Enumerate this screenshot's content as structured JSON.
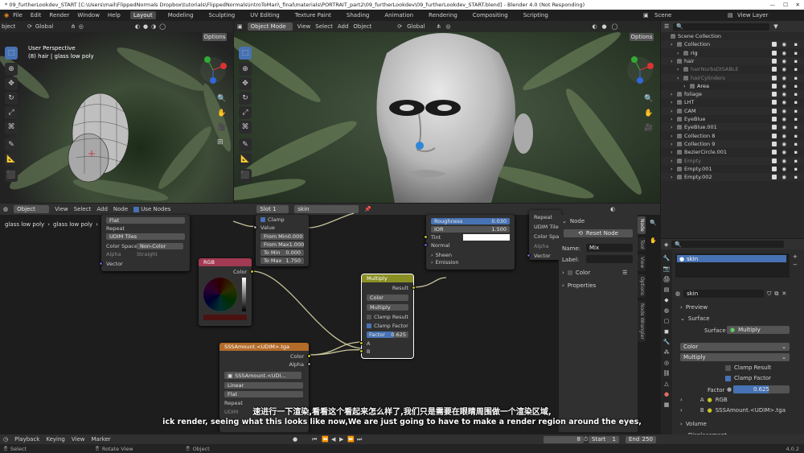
{
  "title_bar": {
    "text": "* 09_furtherLookdev_START [C:\\Users\\mail\\FlippedNormals Dropbox\\tutorials\\FlippedNormals\\introToMari\\_final\\materials\\PORTRAIT_part2\\09_furtherLookdev\\09_furtherLookdev_START.blend] - Blender 4.0 (Not Responding)"
  },
  "menu": {
    "file": "File",
    "edit": "Edit",
    "render": "Render",
    "window": "Window",
    "help": "Help"
  },
  "workspaces": [
    "Layout",
    "Modeling",
    "Sculpting",
    "UV Editing",
    "Texture Paint",
    "Shading",
    "Animation",
    "Rendering",
    "Compositing",
    "Scripting"
  ],
  "scene": {
    "scene_label": "Scene",
    "view_layer_label": "View Layer"
  },
  "viewport_left": {
    "mode_label": "bject",
    "transform": "Global",
    "options": "Options",
    "perspective": "User Perspective",
    "object_info": "(8) hair | glass low poly"
  },
  "viewport_right": {
    "mode_label": "Object Mode",
    "view": "View",
    "select": "Select",
    "add": "Add",
    "object": "Object",
    "transform": "Global",
    "options": "Options"
  },
  "node_header": {
    "object": "Object",
    "view": "View",
    "select": "Select",
    "add": "Add",
    "node": "Node",
    "use_nodes": "Use Nodes",
    "slot": "Slot 1",
    "material": "skin",
    "breadcrumb_1": "glass low poly",
    "breadcrumb_2": "glass low poly",
    "breadcrumb_3": "skin"
  },
  "node_img_top": {
    "flat": "Flat",
    "repeat": "Repeat",
    "udim": "UDIM Tiles",
    "color_space_label": "Color Space",
    "color_space_value": "Non-Color",
    "alpha": "Alpha",
    "straight": "Straight",
    "vector": "Vector"
  },
  "node_map": {
    "clamp": "Clamp",
    "value": "Value",
    "from_min_label": "From Min",
    "from_min": "0.000",
    "from_max_label": "From Max",
    "from_max": "1.000",
    "to_min_label": "To Min",
    "to_min": "0.000",
    "to_max_label": "To Max",
    "to_max": "1.750"
  },
  "node_bsdf": {
    "roughness_label": "Roughness",
    "roughness": "0.030",
    "ior_label": "IOR",
    "ior": "1.500",
    "tint": "Tint",
    "normal": "Normal",
    "sheen": "Sheen",
    "emission": "Emission"
  },
  "node_img_right": {
    "repeat": "Repeat",
    "udim": "UDIM Tile",
    "color_space": "Color Spac",
    "alpha": "Alpha",
    "vector": "Vector"
  },
  "node_rgb": {
    "title": "RGB",
    "color": "Color"
  },
  "node_multiply": {
    "title": "Multiply",
    "result": "Result",
    "type": "Color",
    "mode": "Multiply",
    "clamp_result": "Clamp Result",
    "clamp_factor": "Clamp Factor",
    "factor_label": "Factor",
    "factor_value": "0.625",
    "factor_fraction": 0.625,
    "a": "A",
    "b": "B"
  },
  "node_sss": {
    "title": "SSSAmount.<UDIM>.tga",
    "color": "Color",
    "alpha": "Alpha",
    "image": "SSSAmount.<UDI...",
    "linear": "Linear",
    "flat": "Flat",
    "repeat": "Repeat",
    "udim": "UDIM"
  },
  "node_panel": {
    "section": "Node",
    "reset": "Reset Node",
    "name_label": "Name:",
    "name": "Mix",
    "label_label": "Label:",
    "color": "Color",
    "properties": "Properties"
  },
  "sidebar_tabs": [
    "Node",
    "Tool",
    "View",
    "Options",
    "Node Wrangler"
  ],
  "outliner": {
    "rows": [
      {
        "indent": 0,
        "name": "Scene Collection",
        "color": "#cfcfcf",
        "checks": false
      },
      {
        "indent": 1,
        "name": "Collection",
        "color": "#cfcfcf",
        "checks": true
      },
      {
        "indent": 2,
        "name": "rig",
        "color": "#e0e0e0",
        "checks": true
      },
      {
        "indent": 1,
        "name": "hair",
        "color": "#cfcfcf",
        "checks": true
      },
      {
        "indent": 2,
        "name": "hairNurbsDISABLE",
        "color": "#7d7d7d",
        "checks": true
      },
      {
        "indent": 2,
        "name": "hairCylinders",
        "color": "#7d7d7d",
        "checks": true
      },
      {
        "indent": 3,
        "name": "Area",
        "color": "#e0e0e0",
        "checks": true
      },
      {
        "indent": 1,
        "name": "foliage",
        "color": "#cfcfcf",
        "checks": true
      },
      {
        "indent": 1,
        "name": "LHT",
        "color": "#cfcfcf",
        "checks": true
      },
      {
        "indent": 1,
        "name": "CAM",
        "color": "#cfcfcf",
        "checks": true
      },
      {
        "indent": 1,
        "name": "EyeBlue",
        "color": "#cfcfcf",
        "checks": true
      },
      {
        "indent": 1,
        "name": "EyeBlue.001",
        "color": "#cfcfcf",
        "checks": true
      },
      {
        "indent": 1,
        "name": "Collection 8",
        "color": "#cfcfcf",
        "checks": true
      },
      {
        "indent": 1,
        "name": "Collection 9",
        "color": "#cfcfcf",
        "checks": true
      },
      {
        "indent": 1,
        "name": "BezierCircle.001",
        "color": "#cfcfcf",
        "checks": true
      },
      {
        "indent": 1,
        "name": "Empty",
        "color": "#7d7d7d",
        "checks": true
      },
      {
        "indent": 1,
        "name": "Empty.001",
        "color": "#cfcfcf",
        "checks": true
      },
      {
        "indent": 1,
        "name": "Empty.002",
        "color": "#cfcfcf",
        "checks": true
      }
    ]
  },
  "properties": {
    "material_slot": "skin",
    "material_name": "skin",
    "preview": "Preview",
    "surface_section": "Surface",
    "surface_label": "Surface",
    "surface_value": "Multiply",
    "color": "Color",
    "multiply": "Multiply",
    "clamp_result": "Clamp Result",
    "clamp_factor": "Clamp Factor",
    "factor_label": "Factor",
    "factor_value": "0.625",
    "factor_fraction": 0.625,
    "a_label": "A",
    "a_value": "RGB",
    "b_label": "B",
    "b_value": "SSSAmount.<UDIM>.tga",
    "volume": "Volume",
    "displacement": "Displacement"
  },
  "subtitles": {
    "zh": "速进行一下渲染,看看这个看起来怎么样了,我们只是需要在眼睛周围做一个渲染区域,",
    "en": "ick render, seeing what this looks like now,We are just going to have to make a render region around the eyes,"
  },
  "timeline": {
    "playback": "Playback",
    "keying": "Keying",
    "view": "View",
    "marker": "Marker",
    "frame": "8",
    "start_label": "Start",
    "start": "1",
    "end_label": "End",
    "end": "250"
  },
  "status": {
    "select": "Select",
    "rotate": "Rotate View",
    "object": "Object",
    "version": "4.0.2"
  },
  "colors": {
    "accent": "#4772b3",
    "header_bg": "#303030",
    "rgb_node": "#a13a52",
    "image_node": "#b36b2a",
    "math_node": "#8a8f24",
    "noodle": "#c7c29a"
  }
}
